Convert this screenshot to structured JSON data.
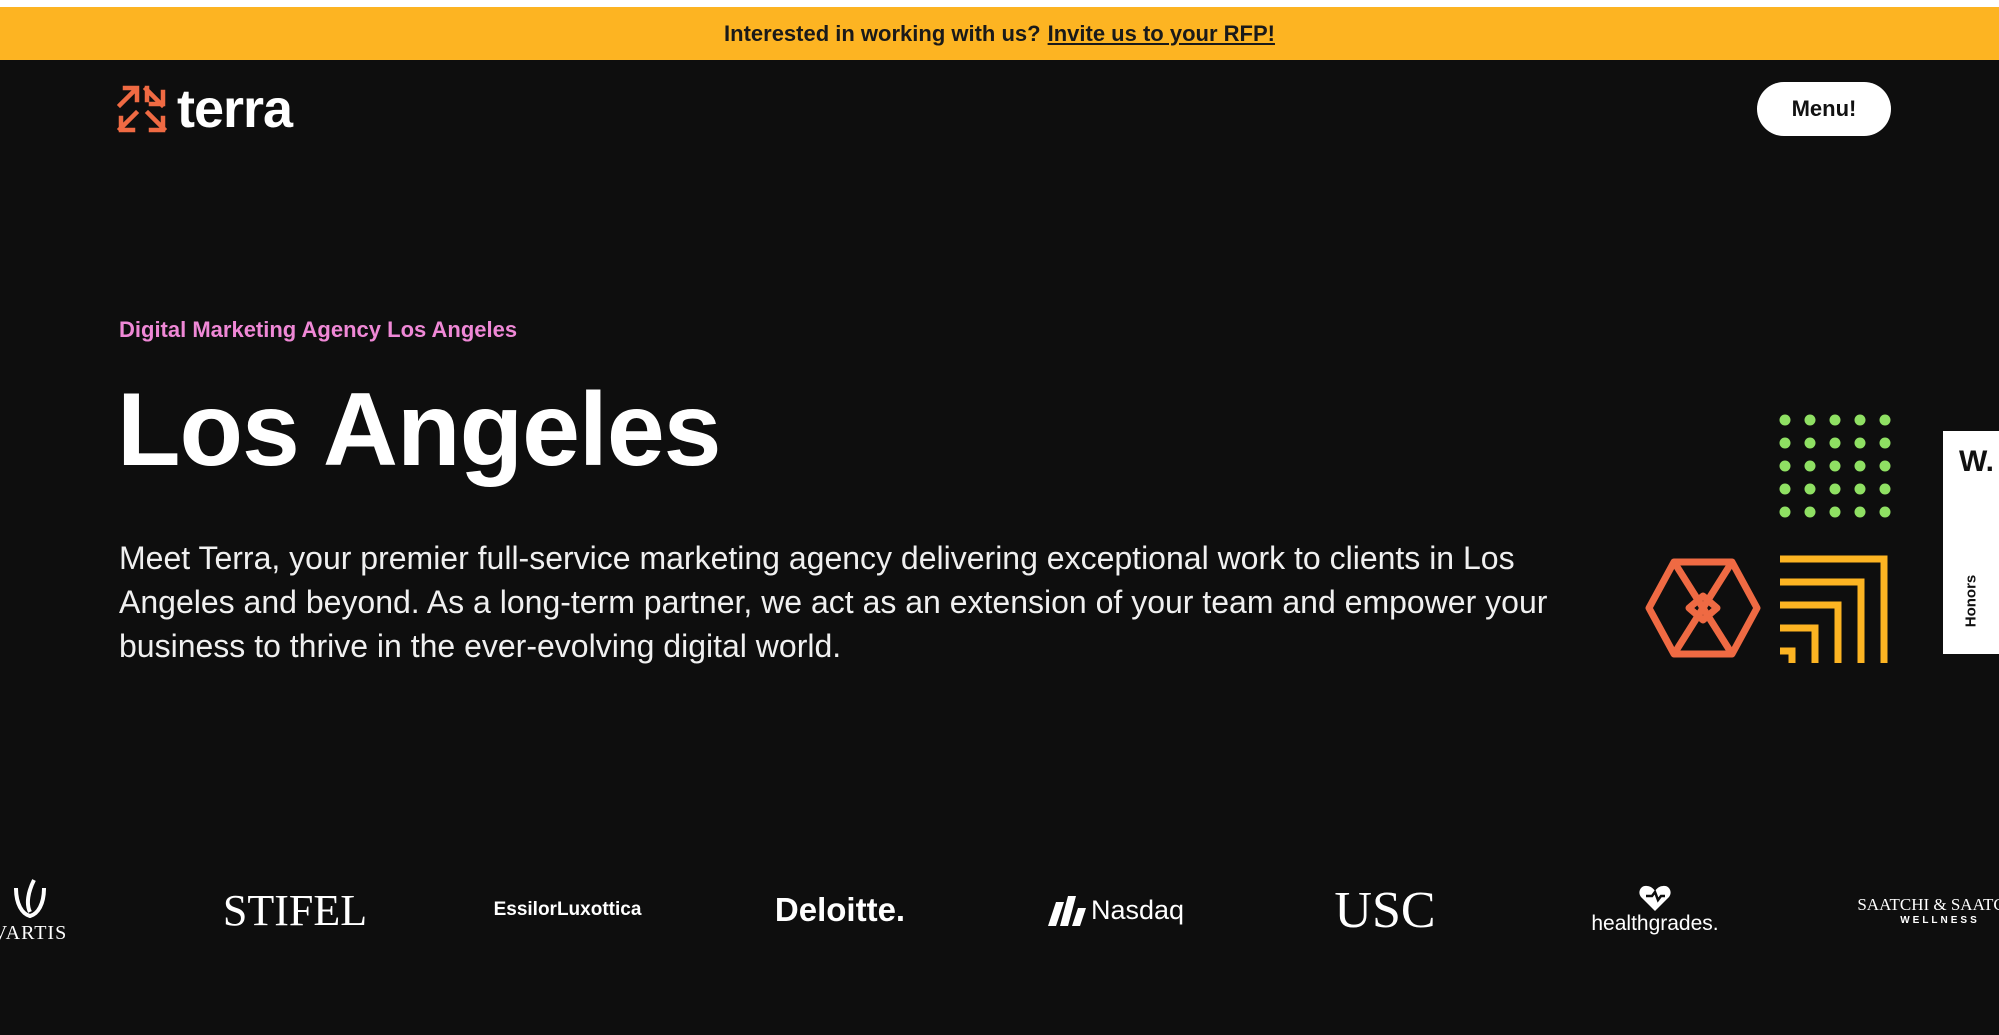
{
  "banner": {
    "text": "Interested in working with us?",
    "link_label": "Invite us to your RFP!"
  },
  "header": {
    "logo_text": "terra",
    "menu_label": "Menu!"
  },
  "hero": {
    "eyebrow": "Digital Marketing Agency Los Angeles",
    "title": "Los Angeles",
    "description": "Meet Terra, your premier full-service marketing agency delivering exceptional work to clients in Los Angeles and beyond. As a long-term partner, we act as an extension of your team and empower your business to thrive in the ever-evolving digital world."
  },
  "honors_tab": {
    "badge": "W.",
    "label": "Honors"
  },
  "clients": [
    {
      "name": "VARTIS",
      "icon": "novartis-flame-icon"
    },
    {
      "name": "STIFEL"
    },
    {
      "name": "EssilorLuxottica"
    },
    {
      "name": "Deloitte."
    },
    {
      "name": "Nasdaq",
      "icon": "nasdaq-mark-icon"
    },
    {
      "name": "USC"
    },
    {
      "name": "healthgrades.",
      "icon": "healthgrades-heart-icon"
    },
    {
      "name": "SAATCHI & SAATCHI",
      "sub": "WELLNESS"
    }
  ],
  "colors": {
    "background": "#0e0e0e",
    "banner": "#fdb422",
    "eyebrow": "#ef88d6",
    "logo_arrows": "#ef6a43",
    "dots": "#8fe063",
    "hexagon": "#ef6a43",
    "stairs": "#fdb422"
  },
  "icons": {
    "logo": "terra-arrows-icon",
    "art": [
      "green-dot-grid-icon",
      "orange-hexagon-icon",
      "yellow-stairs-icon"
    ]
  }
}
